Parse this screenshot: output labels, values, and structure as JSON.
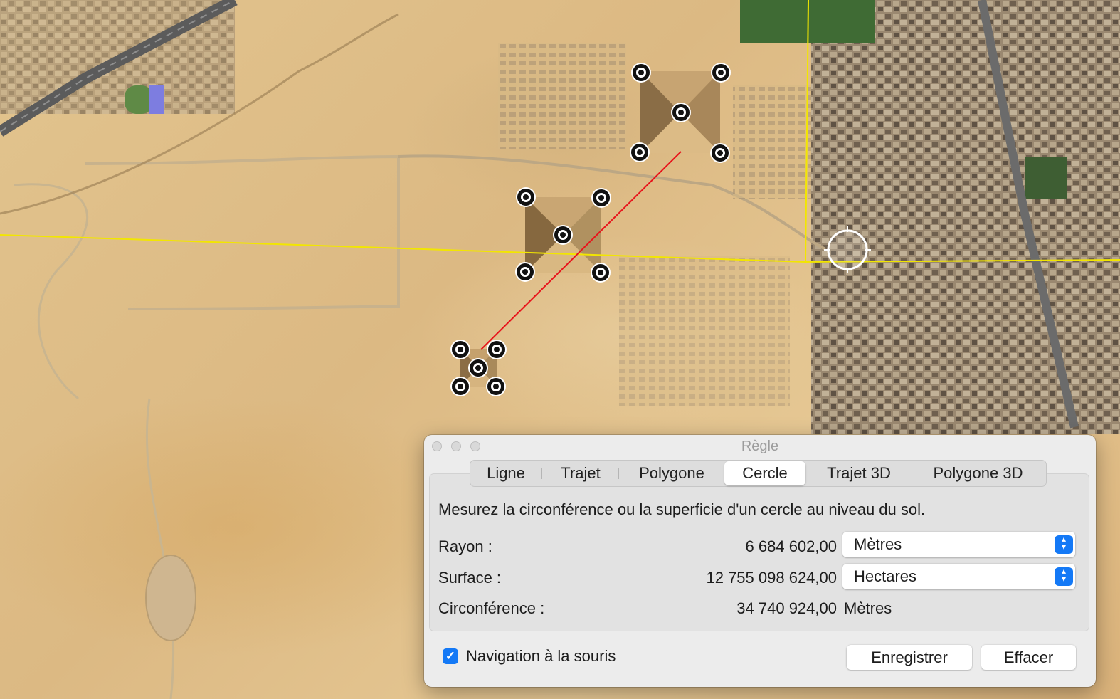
{
  "window": {
    "title": "Règle"
  },
  "tabs": [
    {
      "label": "Ligne",
      "selected": false
    },
    {
      "label": "Trajet",
      "selected": false
    },
    {
      "label": "Polygone",
      "selected": false
    },
    {
      "label": "Cercle",
      "selected": true
    },
    {
      "label": "Trajet 3D",
      "selected": false
    },
    {
      "label": "Polygone 3D",
      "selected": false
    }
  ],
  "description": "Mesurez la circonférence ou la superficie d'un cercle au niveau du sol.",
  "rows": {
    "radius": {
      "label": "Rayon :",
      "value": "6 684 602,00",
      "unit": "Mètres"
    },
    "area": {
      "label": "Surface :",
      "value": "12 755 098 624,00",
      "unit": "Hectares"
    },
    "circumference": {
      "label": "Circonférence :",
      "value": "34 740 924,00",
      "unit": "Mètres"
    }
  },
  "footer": {
    "mouse_navigation": {
      "label": "Navigation à la souris",
      "checked": true
    },
    "save_label": "Enregistrer",
    "clear_label": "Effacer"
  },
  "colors": {
    "accent": "#1479f6",
    "measure_line": "#e8141b",
    "guide_line": "#f2e600"
  }
}
